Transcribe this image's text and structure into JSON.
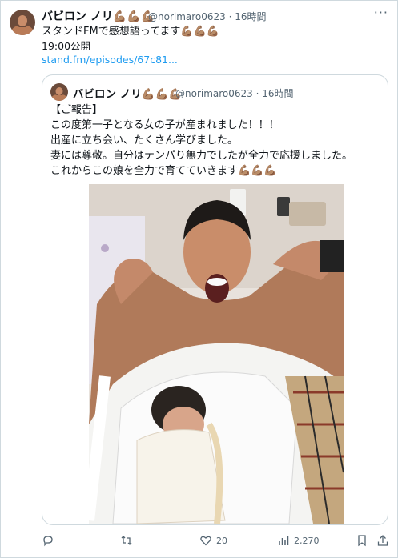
{
  "tweet": {
    "author_name": "バビロン ノリ",
    "muscle_emoji": "💪🏽💪🏽💪🏽",
    "handle": "@norimaro0623",
    "time": "16時間",
    "text": "スタンドFMで感想語ってます💪🏽💪🏽💪🏽",
    "published": "19:00公開",
    "link": "stand.fm/episodes/67c81..."
  },
  "quote": {
    "author_name": "バビロン ノリ",
    "muscle_emoji": "💪🏽💪🏽💪🏽",
    "handle": "@norimaro0623",
    "time": "16時間",
    "lines": [
      "【ご報告】",
      "この度第一子となる女の子が産まれました！！！",
      "出産に立ち会い、たくさん学びました。",
      "妻には尊敬。自分はテンパり無力でしたが全力で応援しました。",
      "これからこの娘を全力で育てていきます💪🏽💪🏽💪🏽"
    ]
  },
  "actions": {
    "reply_count": "",
    "retweet_count": "",
    "like_count": "20",
    "view_count": "2,270"
  },
  "icons": {
    "more": "more-options-icon",
    "reply": "reply-icon",
    "retweet": "retweet-icon",
    "like": "like-icon",
    "views": "views-icon",
    "bookmark": "bookmark-icon",
    "share": "share-icon"
  },
  "colors": {
    "link": "#1d9bf0",
    "secondary_text": "#536471",
    "border": "#cfd9de"
  }
}
